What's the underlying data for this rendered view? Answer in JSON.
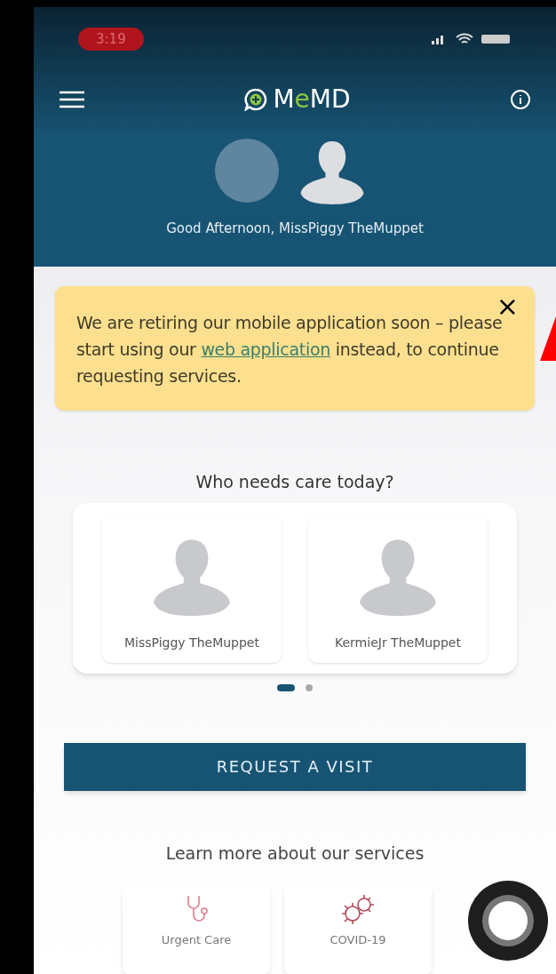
{
  "status_bar": {
    "time": "3:19"
  },
  "header": {
    "logo": [
      {
        "text": "M",
        "highlighted": false
      },
      {
        "text": "e",
        "highlighted": true
      },
      {
        "text": "MD",
        "highlighted": false
      }
    ],
    "greeting": "Good Afternoon, MissPiggy TheMuppet"
  },
  "banner": {
    "text_before": "We are retiring our mobile application soon – please start using our ",
    "link": "web application",
    "text_after": " instead, to continue requesting services.",
    "close": "×"
  },
  "care": {
    "title": "Who needs care today?",
    "profiles": [
      {
        "name": "MissPiggy TheMuppet"
      },
      {
        "name": "KermieJr TheMuppet"
      }
    ],
    "pages": [
      {
        "selected": true
      },
      {
        "selected": false
      }
    ]
  },
  "request_button": "REQUEST A VISIT",
  "services": {
    "title": "Learn more about our services",
    "items": [
      {
        "kind": "stethoscope",
        "label": "Urgent Care"
      },
      {
        "kind": "virus",
        "label": "COVID-19"
      }
    ]
  }
}
